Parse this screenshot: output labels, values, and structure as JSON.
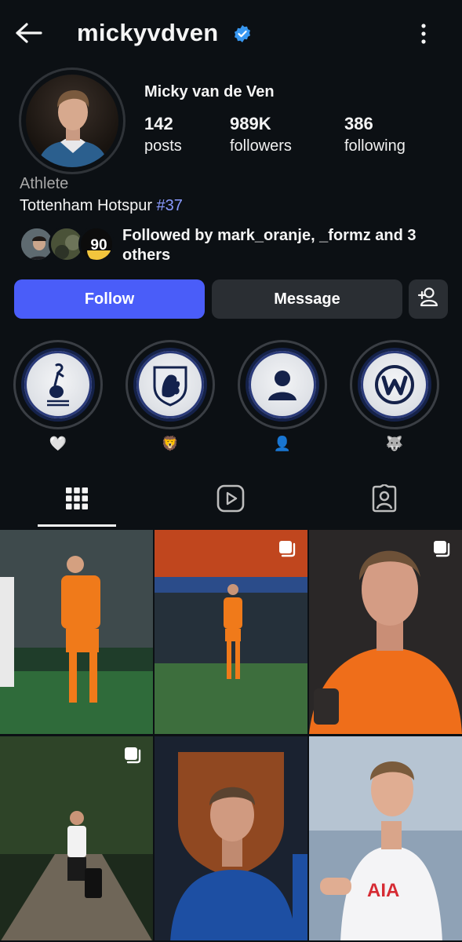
{
  "header": {
    "username": "mickyvdven",
    "back_icon": "arrow-left-icon",
    "verified_icon": "verified-badge-icon",
    "more_icon": "more-vertical-icon"
  },
  "profile": {
    "full_name": "Micky van de Ven",
    "stats": [
      {
        "value": "142",
        "label": "posts"
      },
      {
        "value": "989K",
        "label": "followers"
      },
      {
        "value": "386",
        "label": "following"
      }
    ],
    "category": "Athlete",
    "bio_text": "Tottenham Hotspur",
    "bio_tag": "#37",
    "followed_by": "Followed by mark_oranje, _formz and 3 others",
    "followed_avatar_badge": "90"
  },
  "actions": {
    "follow_label": "Follow",
    "message_label": "Message",
    "add_user_icon": "add-user-icon"
  },
  "highlights": [
    {
      "label": "🤍",
      "icon": "tottenham-crest-icon"
    },
    {
      "label": "🦁",
      "icon": "knvb-lion-crest-icon"
    },
    {
      "label": "👤",
      "icon": "person-silhouette-icon"
    },
    {
      "label": "🐺",
      "icon": "wolfsburg-crest-icon"
    }
  ],
  "tabs": [
    {
      "name": "posts-grid",
      "icon": "grid-icon",
      "active": true
    },
    {
      "name": "reels",
      "icon": "reels-play-icon",
      "active": false
    },
    {
      "name": "tagged",
      "icon": "tagged-person-icon",
      "active": false
    }
  ],
  "colors": {
    "background": "#0c1014",
    "follow_button": "#4a5df9",
    "secondary_button": "#2a2e33",
    "hashtag": "#8a9bff",
    "verified": "#3897f0"
  }
}
